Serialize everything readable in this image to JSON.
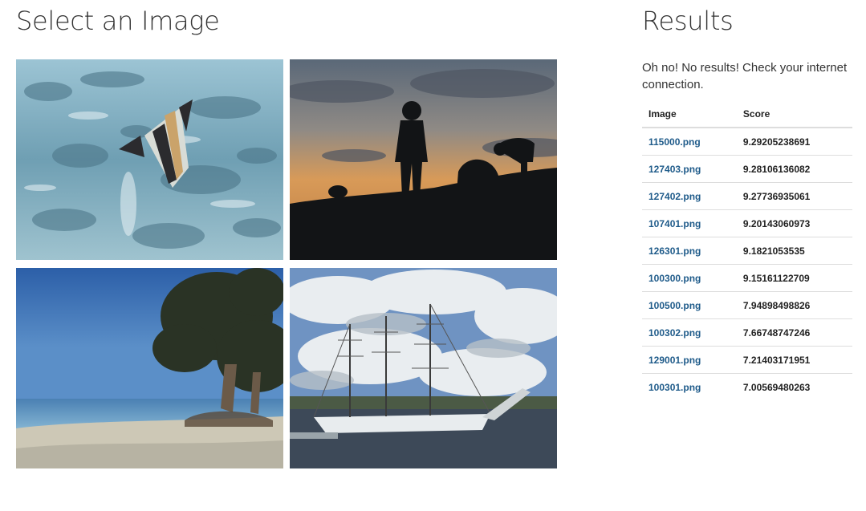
{
  "select": {
    "title": "Select an Image",
    "images": [
      {
        "alt": "fish"
      },
      {
        "alt": "silhouettes"
      },
      {
        "alt": "beach"
      },
      {
        "alt": "ship"
      }
    ]
  },
  "results": {
    "title": "Results",
    "message": "Oh no! No results! Check your internet connection.",
    "columns": {
      "image": "Image",
      "score": "Score"
    },
    "rows": [
      {
        "image": "115000.png",
        "score": "9.29205238691"
      },
      {
        "image": "127403.png",
        "score": "9.28106136082"
      },
      {
        "image": "127402.png",
        "score": "9.27736935061"
      },
      {
        "image": "107401.png",
        "score": "9.20143060973"
      },
      {
        "image": "126301.png",
        "score": "9.1821053535"
      },
      {
        "image": "100300.png",
        "score": "9.15161122709"
      },
      {
        "image": "100500.png",
        "score": "7.94898498826"
      },
      {
        "image": "100302.png",
        "score": "7.66748747246"
      },
      {
        "image": "129001.png",
        "score": "7.21403171951"
      },
      {
        "image": "100301.png",
        "score": "7.00569480263"
      }
    ]
  }
}
